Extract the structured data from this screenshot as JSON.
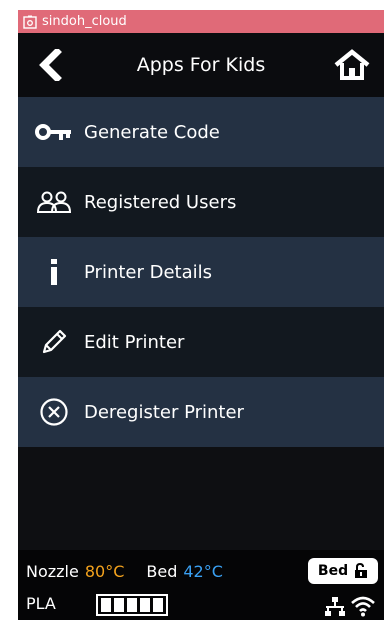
{
  "titlebar": {
    "app_name": "sindoh_cloud",
    "icon": "camera-icon",
    "color": "#e06a78"
  },
  "header": {
    "title": "Apps For Kids",
    "back_icon": "chevron-left-icon",
    "home_icon": "home-icon"
  },
  "menu": [
    {
      "label": "Generate Code",
      "icon": "key-icon"
    },
    {
      "label": "Registered Users",
      "icon": "users-icon"
    },
    {
      "label": "Printer Details",
      "icon": "info-icon"
    },
    {
      "label": "Edit Printer",
      "icon": "pencil-icon"
    },
    {
      "label": "Deregister Printer",
      "icon": "x-circle-icon"
    }
  ],
  "status": {
    "nozzle_label": "Nozzle",
    "nozzle_temp": "80°C",
    "bed_label": "Bed",
    "bed_temp": "42°C",
    "bed_button_label": "Bed",
    "bed_button_icon": "unlock-icon",
    "filament_type": "PLA",
    "filament_level_segments": 5,
    "network_icon": "network-icon",
    "wifi_icon": "wifi-icon",
    "colors": {
      "nozzle_temp": "#f3a21d",
      "bed_temp": "#3aa0f2"
    }
  }
}
